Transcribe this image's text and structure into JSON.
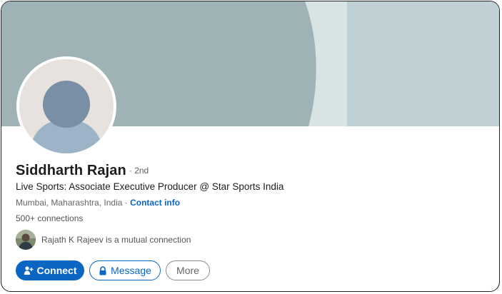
{
  "profile": {
    "name": "Siddharth Rajan",
    "degree": "· 2nd",
    "headline": "Live Sports: Associate Executive Producer @ Star Sports India",
    "location": "Mumbai, Maharashtra, India ·",
    "contact_info_label": "Contact info",
    "connections": "500+ connections",
    "mutual_connection": "Rajath K Rajeev is a mutual connection"
  },
  "actions": {
    "connect_label": "Connect",
    "message_label": "Message",
    "more_label": "More"
  },
  "icons": {
    "connect": "add-person-icon",
    "message": "lock-icon",
    "avatar": "default-person-silhouette",
    "mutual_avatar": "person-photo"
  },
  "colors": {
    "brand_blue": "#0a66c2",
    "banner_light": "#bfd1d5",
    "banner_mid": "#d9e4e5",
    "banner_dark": "#9fb2b5"
  }
}
